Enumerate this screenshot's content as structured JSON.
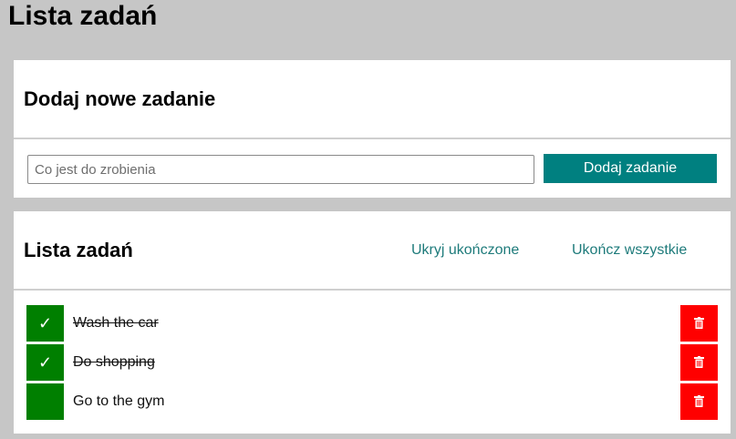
{
  "page": {
    "title": "Lista zadań"
  },
  "add_card": {
    "title": "Dodaj nowe zadanie",
    "input_placeholder": "Co jest do zrobienia",
    "input_value": "",
    "button_label": "Dodaj zadanie"
  },
  "list_card": {
    "title": "Lista zadań",
    "hide_completed_label": "Ukryj ukończone",
    "complete_all_label": "Ukończ wszystkie",
    "check_glyph": "✓",
    "tasks": [
      {
        "text": "Wash the car",
        "completed": true
      },
      {
        "text": "Do shopping",
        "completed": true
      },
      {
        "text": "Go to the gym",
        "completed": false
      }
    ]
  },
  "colors": {
    "background": "#c6c6c6",
    "accent": "#008080",
    "check": "#007f00",
    "delete": "#ff0000",
    "link": "#1e7b7b"
  },
  "icons": {
    "delete": "trash-icon",
    "check": "checkmark-icon"
  }
}
